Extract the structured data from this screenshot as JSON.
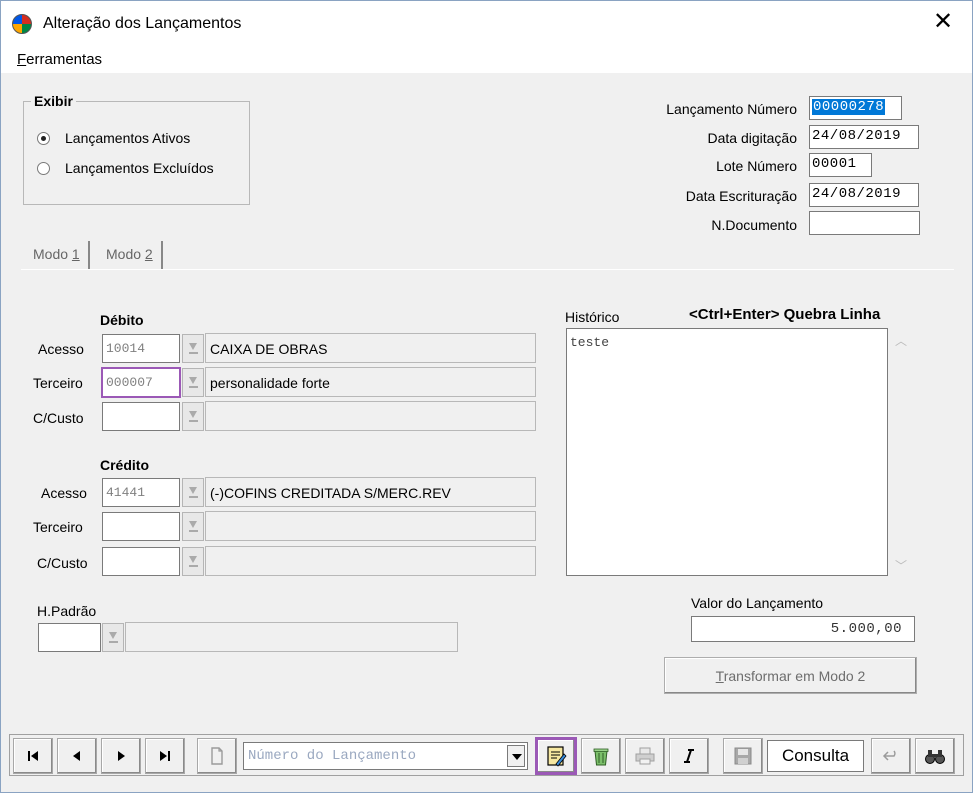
{
  "window": {
    "title": "Alteração dos Lançamentos",
    "close_label": "✕"
  },
  "menu": {
    "ferramentas_first": "F",
    "ferramentas_rest": "erramentas"
  },
  "exibir": {
    "title": "Exibir",
    "options": [
      {
        "label": "Lançamentos Ativos",
        "checked": true
      },
      {
        "label": "Lançamentos Excluídos",
        "checked": false
      }
    ]
  },
  "header": {
    "lancamento_numero_label": "Lançamento Número",
    "lancamento_numero_value": "00000278",
    "data_digitacao_label": "Data digitação",
    "data_digitacao_value": "24/08/2019",
    "lote_numero_label": "Lote Número",
    "lote_numero_value": "00001",
    "data_escrituracao_label": "Data Escrituração",
    "data_escrituracao_value": "24/08/2019",
    "n_documento_label": "N.Documento",
    "n_documento_value": ""
  },
  "tabs": [
    {
      "text": "Modo ",
      "accel": "1"
    },
    {
      "text": "Modo ",
      "accel": "2"
    }
  ],
  "debito": {
    "title": "Débito",
    "acesso_label": "Acesso",
    "acesso_code": "10014",
    "acesso_desc": "CAIXA DE OBRAS",
    "terceiro_label": "Terceiro",
    "terceiro_code": "000007",
    "terceiro_desc": "personalidade forte",
    "ccusto_label": "C/Custo",
    "ccusto_code": "",
    "ccusto_desc": ""
  },
  "credito": {
    "title": "Crédito",
    "acesso_label": "Acesso",
    "acesso_code": "41441",
    "acesso_desc": "(-)COFINS CREDITADA S/MERC.REV",
    "terceiro_label": "Terceiro",
    "terceiro_code": "",
    "terceiro_desc": "",
    "ccusto_label": "C/Custo",
    "ccusto_code": "",
    "ccusto_desc": ""
  },
  "hpadrao": {
    "label": "H.Padrão",
    "code": "",
    "desc": ""
  },
  "historico": {
    "label": "Histórico",
    "hint": "<Ctrl+Enter> Quebra Linha",
    "text": "teste"
  },
  "valor": {
    "label": "Valor do Lançamento",
    "value": "5.000,00"
  },
  "transformar": {
    "accel": "T",
    "rest": "ransformar em  Modo 2"
  },
  "toolbar": {
    "first_icon": "first-record-icon",
    "prev_icon": "prev-record-icon",
    "next_icon": "next-record-icon",
    "last_icon": "last-record-icon",
    "new_icon": "new-document-icon",
    "combo_placeholder": "Número do Lançamento",
    "status": "Consulta",
    "highlight_color": "#9b59b6",
    "selection_color": "#0078d7"
  }
}
